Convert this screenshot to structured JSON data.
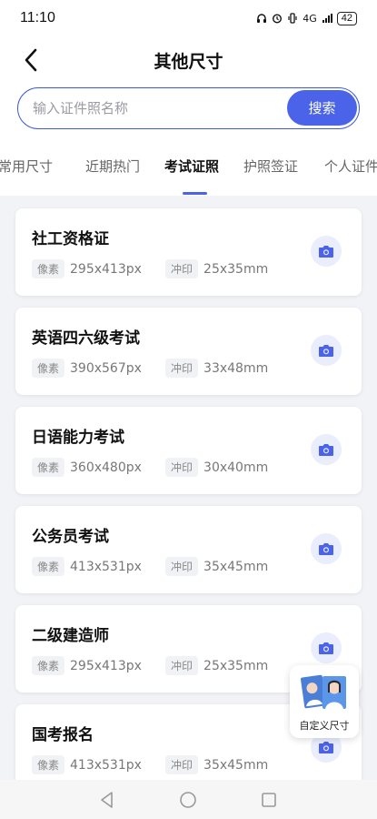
{
  "status_bar": {
    "time": "11:10",
    "network": "4G",
    "battery": "42"
  },
  "header": {
    "title": "其他尺寸"
  },
  "search": {
    "placeholder": "输入证件照名称",
    "button_label": "搜索"
  },
  "tabs": [
    {
      "label": "常用尺寸"
    },
    {
      "label": "近期热门"
    },
    {
      "label": "考试证照",
      "active": true
    },
    {
      "label": "护照签证"
    },
    {
      "label": "个人证件"
    }
  ],
  "labels": {
    "pixel": "像素",
    "print": "冲印"
  },
  "items": [
    {
      "name": "社工资格证",
      "pixels": "295x413px",
      "print": "25x35mm"
    },
    {
      "name": "英语四六级考试",
      "pixels": "390x567px",
      "print": "33x48mm"
    },
    {
      "name": "日语能力考试",
      "pixels": "360x480px",
      "print": "30x40mm"
    },
    {
      "name": "公务员考试",
      "pixels": "413x531px",
      "print": "35x45mm"
    },
    {
      "name": "二级建造师",
      "pixels": "295x413px",
      "print": "25x35mm"
    },
    {
      "name": "国考报名",
      "pixels": "413x531px",
      "print": "35x45mm"
    }
  ],
  "fab": {
    "label": "自定义尺寸"
  },
  "colors": {
    "accent": "#4a63e8",
    "background": "#f2f3f7"
  }
}
